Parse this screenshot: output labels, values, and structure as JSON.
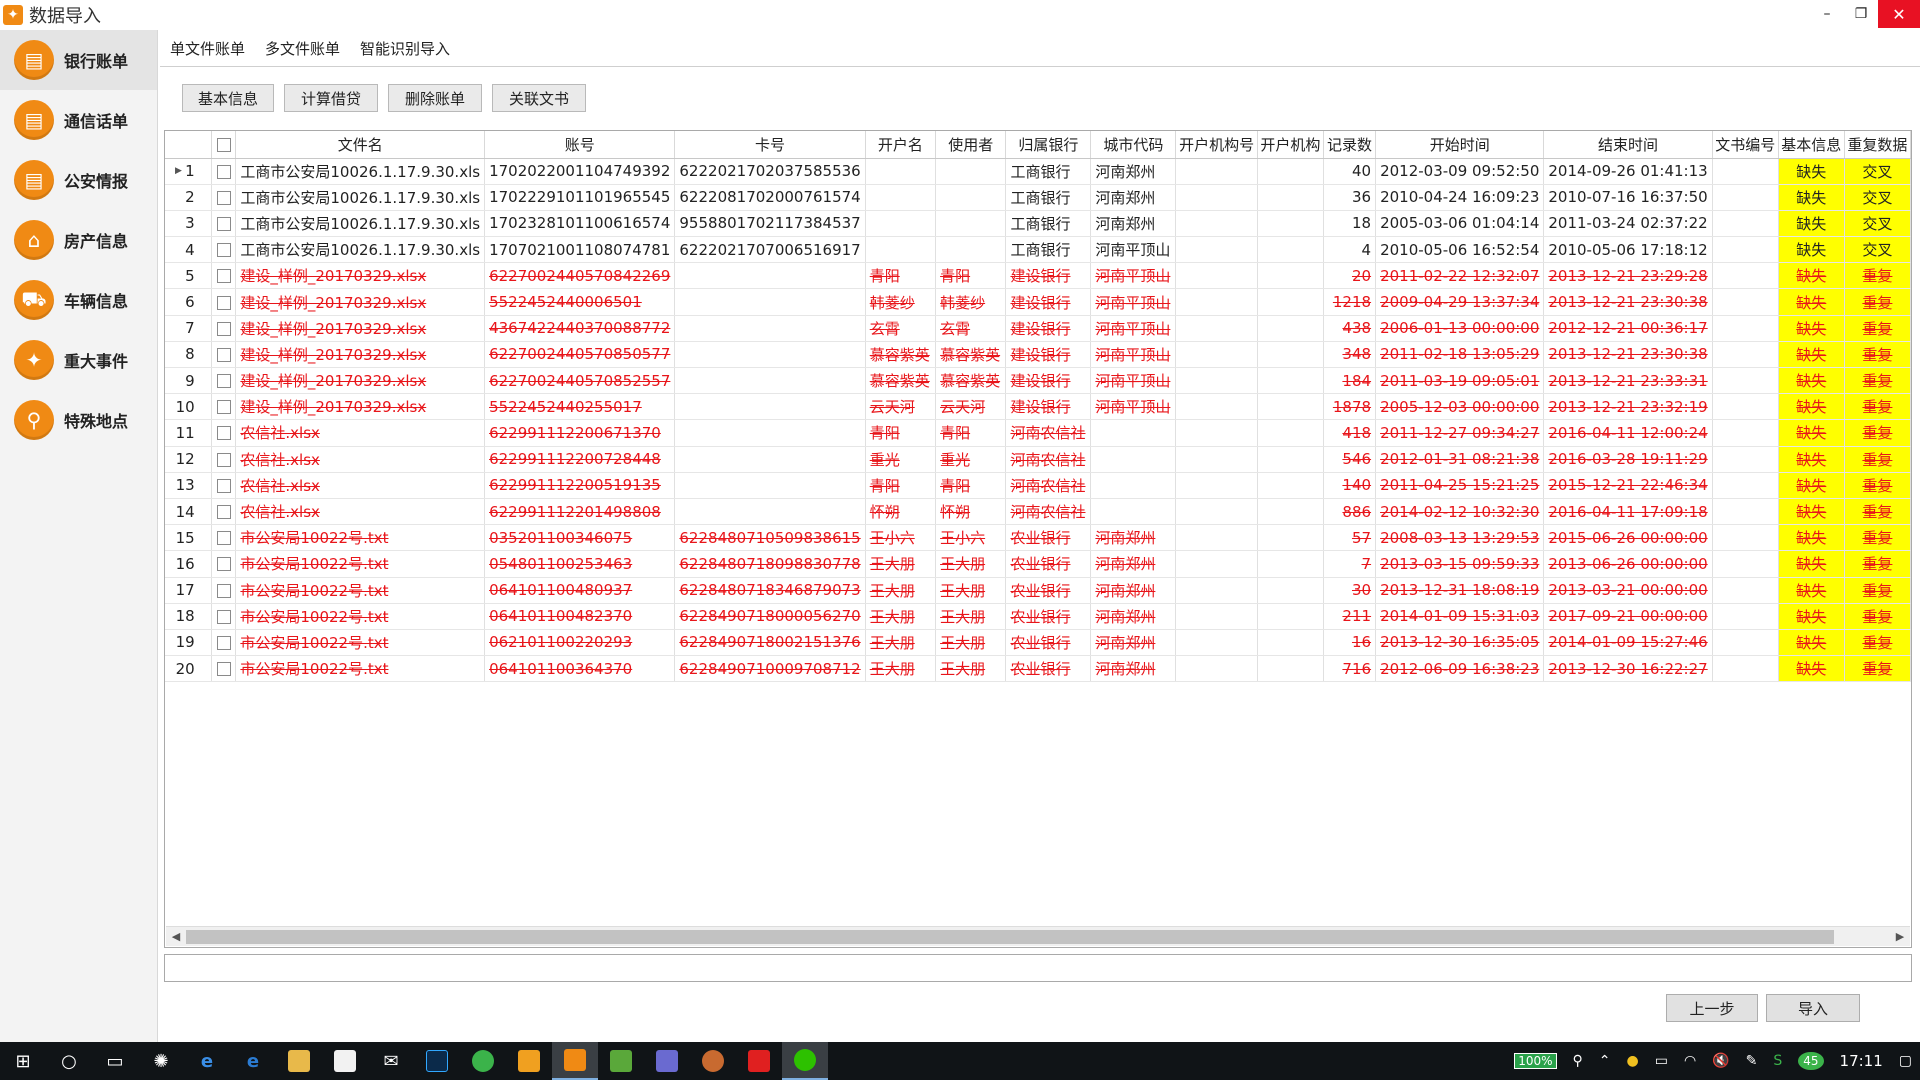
{
  "window": {
    "title": "数据导入"
  },
  "sidebar": {
    "items": [
      {
        "label": "银行账单",
        "icon": "bank-bill-icon",
        "active": true
      },
      {
        "label": "通信话单",
        "icon": "phone-bill-icon",
        "active": false
      },
      {
        "label": "公安情报",
        "icon": "police-intel-icon",
        "active": false
      },
      {
        "label": "房产信息",
        "icon": "house-icon",
        "active": false
      },
      {
        "label": "车辆信息",
        "icon": "car-icon",
        "active": false
      },
      {
        "label": "重大事件",
        "icon": "running-person-icon",
        "active": false
      },
      {
        "label": "特殊地点",
        "icon": "map-pin-icon",
        "active": false
      }
    ]
  },
  "tabs": [
    "单文件账单",
    "多文件账单",
    "智能识别导入"
  ],
  "toolbar": {
    "basic_info": "基本信息",
    "calc_loan": "计算借贷",
    "delete_bill": "删除账单",
    "related_doc": "关联文书"
  },
  "grid": {
    "columns": [
      "",
      "文件名",
      "账号",
      "卡号",
      "开户名",
      "使用者",
      "归属银行",
      "城市代码",
      "开户机构号",
      "开户机构",
      "记录数",
      "开始时间",
      "结束时间",
      "文书编号",
      "基本信息",
      "重复数据"
    ],
    "rows": [
      {
        "n": "1",
        "file": "工商市公安局10026.1.17.9.30.xls",
        "acct": "1702022001104749392",
        "card": "6222021702037585536",
        "owner": "",
        "user": "",
        "bank": "工商银行",
        "city": "河南郑州",
        "org_no": "",
        "org": "",
        "count": "40",
        "start": "2012-03-09 09:52:50",
        "end": "2014-09-26 01:41:13",
        "doc": "",
        "info": "缺失",
        "dup": "交叉",
        "bad": false
      },
      {
        "n": "2",
        "file": "工商市公安局10026.1.17.9.30.xls",
        "acct": "1702229101101965545",
        "card": "6222081702000761574",
        "owner": "",
        "user": "",
        "bank": "工商银行",
        "city": "河南郑州",
        "org_no": "",
        "org": "",
        "count": "36",
        "start": "2010-04-24 16:09:23",
        "end": "2010-07-16 16:37:50",
        "doc": "",
        "info": "缺失",
        "dup": "交叉",
        "bad": false
      },
      {
        "n": "3",
        "file": "工商市公安局10026.1.17.9.30.xls",
        "acct": "1702328101100616574",
        "card": "9558801702117384537",
        "owner": "",
        "user": "",
        "bank": "工商银行",
        "city": "河南郑州",
        "org_no": "",
        "org": "",
        "count": "18",
        "start": "2005-03-06 01:04:14",
        "end": "2011-03-24 02:37:22",
        "doc": "",
        "info": "缺失",
        "dup": "交叉",
        "bad": false
      },
      {
        "n": "4",
        "file": "工商市公安局10026.1.17.9.30.xls",
        "acct": "1707021001108074781",
        "card": "6222021707006516917",
        "owner": "",
        "user": "",
        "bank": "工商银行",
        "city": "河南平顶山",
        "org_no": "",
        "org": "",
        "count": "4",
        "start": "2010-05-06 16:52:54",
        "end": "2010-05-06 17:18:12",
        "doc": "",
        "info": "缺失",
        "dup": "交叉",
        "bad": false
      },
      {
        "n": "5",
        "file": "建设_样例_20170329.xlsx",
        "acct": "6227002440570842269",
        "card": "",
        "owner": "青阳",
        "user": "青阳",
        "bank": "建设银行",
        "city": "河南平顶山",
        "org_no": "",
        "org": "",
        "count": "20",
        "start": "2011-02-22 12:32:07",
        "end": "2013-12-21 23:29:28",
        "doc": "",
        "info": "缺失",
        "dup": "重复",
        "bad": true
      },
      {
        "n": "6",
        "file": "建设_样例_20170329.xlsx",
        "acct": "5522452440006501",
        "card": "",
        "owner": "韩菱纱",
        "user": "韩菱纱",
        "bank": "建设银行",
        "city": "河南平顶山",
        "org_no": "",
        "org": "",
        "count": "1218",
        "start": "2009-04-29 13:37:34",
        "end": "2013-12-21 23:30:38",
        "doc": "",
        "info": "缺失",
        "dup": "重复",
        "bad": true
      },
      {
        "n": "7",
        "file": "建设_样例_20170329.xlsx",
        "acct": "4367422440370088772",
        "card": "",
        "owner": "玄霄",
        "user": "玄霄",
        "bank": "建设银行",
        "city": "河南平顶山",
        "org_no": "",
        "org": "",
        "count": "438",
        "start": "2006-01-13 00:00:00",
        "end": "2012-12-21 00:36:17",
        "doc": "",
        "info": "缺失",
        "dup": "重复",
        "bad": true
      },
      {
        "n": "8",
        "file": "建设_样例_20170329.xlsx",
        "acct": "6227002440570850577",
        "card": "",
        "owner": "慕容紫英",
        "user": "慕容紫英",
        "bank": "建设银行",
        "city": "河南平顶山",
        "org_no": "",
        "org": "",
        "count": "348",
        "start": "2011-02-18 13:05:29",
        "end": "2013-12-21 23:30:38",
        "doc": "",
        "info": "缺失",
        "dup": "重复",
        "bad": true
      },
      {
        "n": "9",
        "file": "建设_样例_20170329.xlsx",
        "acct": "6227002440570852557",
        "card": "",
        "owner": "慕容紫英",
        "user": "慕容紫英",
        "bank": "建设银行",
        "city": "河南平顶山",
        "org_no": "",
        "org": "",
        "count": "184",
        "start": "2011-03-19 09:05:01",
        "end": "2013-12-21 23:33:31",
        "doc": "",
        "info": "缺失",
        "dup": "重复",
        "bad": true
      },
      {
        "n": "10",
        "file": "建设_样例_20170329.xlsx",
        "acct": "5522452440255017",
        "card": "",
        "owner": "云天河",
        "user": "云天河",
        "bank": "建设银行",
        "city": "河南平顶山",
        "org_no": "",
        "org": "",
        "count": "1878",
        "start": "2005-12-03 00:00:00",
        "end": "2013-12-21 23:32:19",
        "doc": "",
        "info": "缺失",
        "dup": "重复",
        "bad": true
      },
      {
        "n": "11",
        "file": "农信社.xlsx",
        "acct": "622991112200671370",
        "card": "",
        "owner": "青阳",
        "user": "青阳",
        "bank": "河南农信社",
        "city": "",
        "org_no": "",
        "org": "",
        "count": "418",
        "start": "2011-12-27 09:34:27",
        "end": "2016-04-11 12:00:24",
        "doc": "",
        "info": "缺失",
        "dup": "重复",
        "bad": true
      },
      {
        "n": "12",
        "file": "农信社.xlsx",
        "acct": "622991112200728448",
        "card": "",
        "owner": "重光",
        "user": "重光",
        "bank": "河南农信社",
        "city": "",
        "org_no": "",
        "org": "",
        "count": "546",
        "start": "2012-01-31 08:21:38",
        "end": "2016-03-28 19:11:29",
        "doc": "",
        "info": "缺失",
        "dup": "重复",
        "bad": true
      },
      {
        "n": "13",
        "file": "农信社.xlsx",
        "acct": "622991112200519135",
        "card": "",
        "owner": "青阳",
        "user": "青阳",
        "bank": "河南农信社",
        "city": "",
        "org_no": "",
        "org": "",
        "count": "140",
        "start": "2011-04-25 15:21:25",
        "end": "2015-12-21 22:46:34",
        "doc": "",
        "info": "缺失",
        "dup": "重复",
        "bad": true
      },
      {
        "n": "14",
        "file": "农信社.xlsx",
        "acct": "622991112201498808",
        "card": "",
        "owner": "怀朔",
        "user": "怀朔",
        "bank": "河南农信社",
        "city": "",
        "org_no": "",
        "org": "",
        "count": "886",
        "start": "2014-02-12 10:32:30",
        "end": "2016-04-11 17:09:18",
        "doc": "",
        "info": "缺失",
        "dup": "重复",
        "bad": true
      },
      {
        "n": "15",
        "file": "市公安局10022号.txt",
        "acct": "035201100346075",
        "card": "6228480710509838615",
        "owner": "王小六",
        "user": "王小六",
        "bank": "农业银行",
        "city": "河南郑州",
        "org_no": "",
        "org": "",
        "count": "57",
        "start": "2008-03-13 13:29:53",
        "end": "2015-06-26 00:00:00",
        "doc": "",
        "info": "缺失",
        "dup": "重复",
        "bad": true
      },
      {
        "n": "16",
        "file": "市公安局10022号.txt",
        "acct": "054801100253463",
        "card": "6228480718098830778",
        "owner": "王大朋",
        "user": "王大朋",
        "bank": "农业银行",
        "city": "河南郑州",
        "org_no": "",
        "org": "",
        "count": "7",
        "start": "2013-03-15 09:59:33",
        "end": "2013-06-26 00:00:00",
        "doc": "",
        "info": "缺失",
        "dup": "重复",
        "bad": true
      },
      {
        "n": "17",
        "file": "市公安局10022号.txt",
        "acct": "064101100480937",
        "card": "6228480718346879073",
        "owner": "王大朋",
        "user": "王大朋",
        "bank": "农业银行",
        "city": "河南郑州",
        "org_no": "",
        "org": "",
        "count": "30",
        "start": "2013-12-31 18:08:19",
        "end": "2013-03-21 00:00:00",
        "doc": "",
        "info": "缺失",
        "dup": "重复",
        "bad": true
      },
      {
        "n": "18",
        "file": "市公安局10022号.txt",
        "acct": "064101100482370",
        "card": "6228490718000056270",
        "owner": "王大朋",
        "user": "王大朋",
        "bank": "农业银行",
        "city": "河南郑州",
        "org_no": "",
        "org": "",
        "count": "211",
        "start": "2014-01-09 15:31:03",
        "end": "2017-09-21 00:00:00",
        "doc": "",
        "info": "缺失",
        "dup": "重复",
        "bad": true
      },
      {
        "n": "19",
        "file": "市公安局10022号.txt",
        "acct": "062101100220293",
        "card": "6228490718002151376",
        "owner": "王大朋",
        "user": "王大朋",
        "bank": "农业银行",
        "city": "河南郑州",
        "org_no": "",
        "org": "",
        "count": "16",
        "start": "2013-12-30 16:35:05",
        "end": "2014-01-09 15:27:46",
        "doc": "",
        "info": "缺失",
        "dup": "重复",
        "bad": true
      },
      {
        "n": "20",
        "file": "市公安局10022号.txt",
        "acct": "064101100364370",
        "card": "6228490710009708712",
        "owner": "王大朋",
        "user": "王大朋",
        "bank": "农业银行",
        "city": "河南郑州",
        "org_no": "",
        "org": "",
        "count": "716",
        "start": "2012-06-09 16:38:23",
        "end": "2013-12-30 16:22:27",
        "doc": "",
        "info": "缺失",
        "dup": "重复",
        "bad": true
      }
    ]
  },
  "buttons": {
    "prev": "上一步",
    "import": "导入"
  },
  "taskbar": {
    "battery": "100%",
    "badge": "45",
    "clock": "17:11"
  },
  "colors": {
    "accent": "#f08a14",
    "error": "#e8151a",
    "flag": "#ffff00",
    "taskbar": "#101417"
  }
}
